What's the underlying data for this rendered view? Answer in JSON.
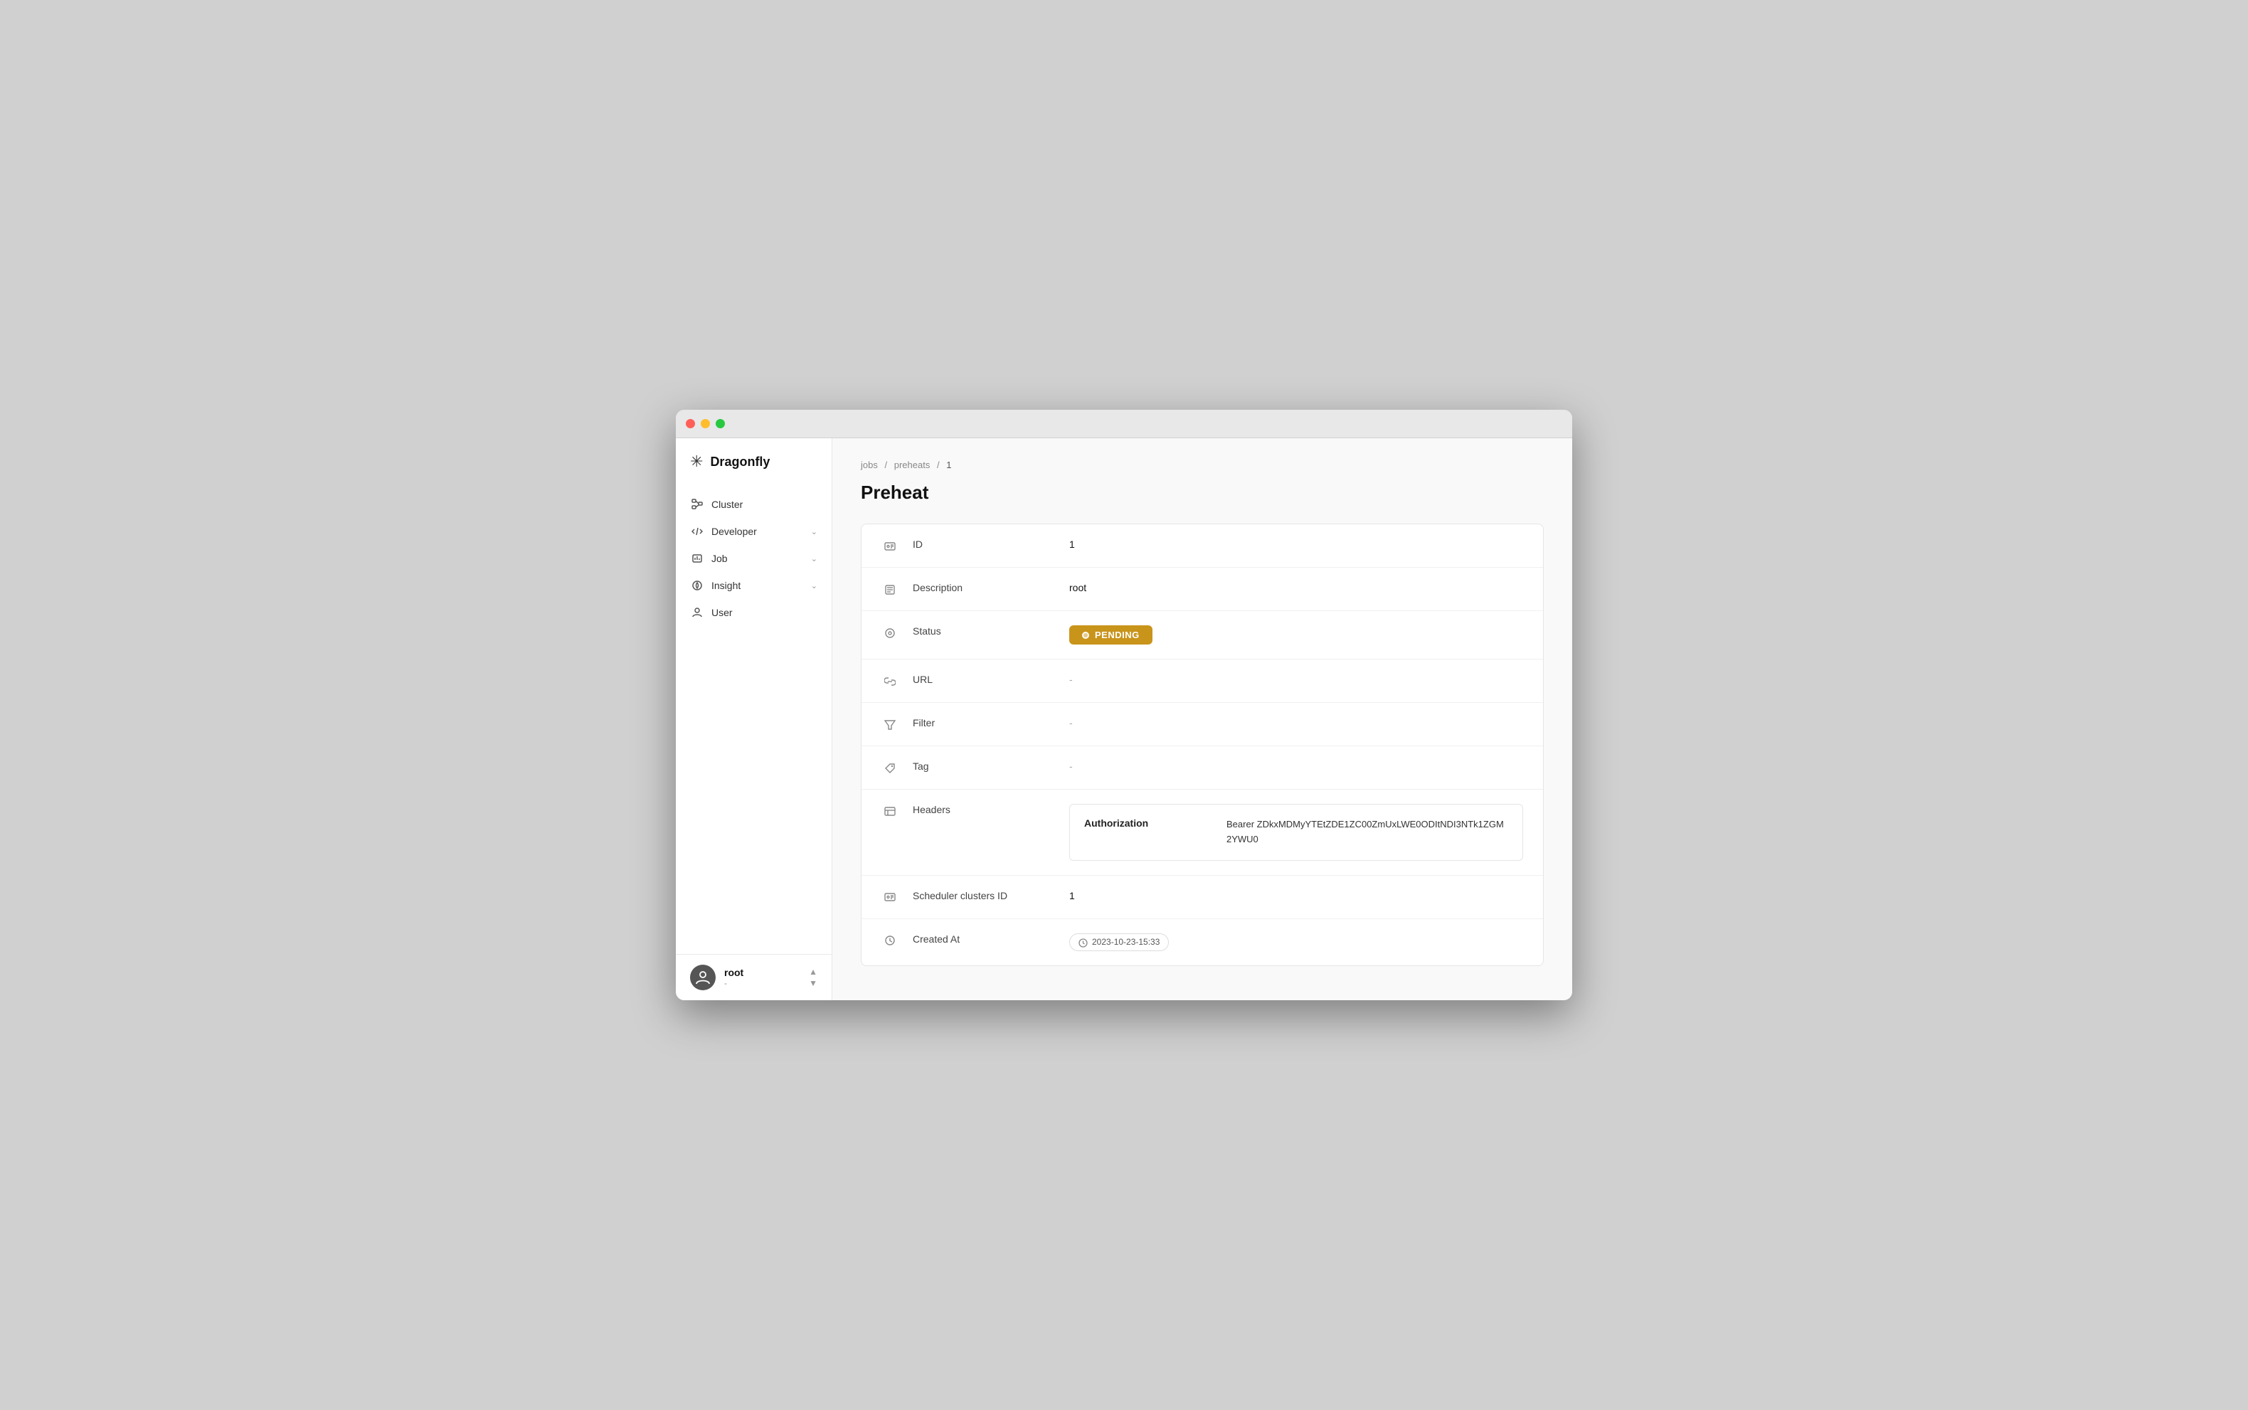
{
  "window": {
    "title": "Dragonfly"
  },
  "sidebar": {
    "logo": {
      "icon": "✳",
      "text": "Dragonfly"
    },
    "items": [
      {
        "id": "cluster",
        "label": "Cluster",
        "icon": "cluster",
        "hasChevron": false
      },
      {
        "id": "developer",
        "label": "Developer",
        "icon": "developer",
        "hasChevron": true
      },
      {
        "id": "job",
        "label": "Job",
        "icon": "job",
        "hasChevron": true
      },
      {
        "id": "insight",
        "label": "Insight",
        "icon": "insight",
        "hasChevron": true
      },
      {
        "id": "user",
        "label": "User",
        "icon": "user",
        "hasChevron": false
      }
    ],
    "footer": {
      "username": "root",
      "role": "-"
    }
  },
  "breadcrumb": {
    "items": [
      "jobs",
      "preheats",
      "1"
    ]
  },
  "page": {
    "title": "Preheat"
  },
  "detail": {
    "fields": [
      {
        "id": "id",
        "label": "ID",
        "value": "1",
        "type": "text"
      },
      {
        "id": "description",
        "label": "Description",
        "value": "root",
        "type": "text"
      },
      {
        "id": "status",
        "label": "Status",
        "value": "PENDING",
        "type": "status"
      },
      {
        "id": "url",
        "label": "URL",
        "value": "-",
        "type": "muted"
      },
      {
        "id": "filter",
        "label": "Filter",
        "value": "-",
        "type": "muted"
      },
      {
        "id": "tag",
        "label": "Tag",
        "value": "-",
        "type": "muted"
      },
      {
        "id": "headers",
        "label": "Headers",
        "type": "headers",
        "headers": [
          {
            "key": "Authorization",
            "value": "Bearer ZDkxMDMyYTEtZDE1ZC00ZmUxLWE0ODItNDI3NTk1ZGM2YWU0"
          }
        ]
      },
      {
        "id": "scheduler_clusters_id",
        "label": "Scheduler clusters ID",
        "value": "1",
        "type": "text"
      },
      {
        "id": "created_at",
        "label": "Created At",
        "value": "2023-10-23-15:33",
        "type": "time"
      }
    ]
  },
  "status_colors": {
    "pending": "#c9941a"
  },
  "labels": {
    "pending": "PENDING"
  }
}
